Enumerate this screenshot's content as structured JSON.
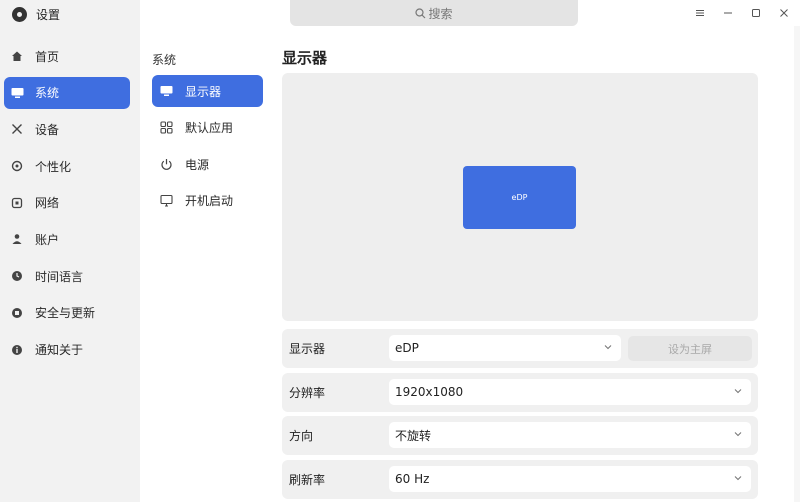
{
  "app": {
    "title": "设置"
  },
  "search": {
    "placeholder": "搜索"
  },
  "sidebar": {
    "items": [
      {
        "label": "首页",
        "icon": "home-icon"
      },
      {
        "label": "系统",
        "icon": "monitor-icon",
        "active": true
      },
      {
        "label": "设备",
        "icon": "tools-icon"
      },
      {
        "label": "个性化",
        "icon": "palette-icon"
      },
      {
        "label": "网络",
        "icon": "network-icon"
      },
      {
        "label": "账户",
        "icon": "user-icon"
      },
      {
        "label": "时间语言",
        "icon": "clock-icon"
      },
      {
        "label": "安全与更新",
        "icon": "shield-icon"
      },
      {
        "label": "通知关于",
        "icon": "info-icon"
      }
    ]
  },
  "subnav": {
    "heading": "系统",
    "items": [
      {
        "label": "显示器",
        "icon": "monitor-icon",
        "active": true
      },
      {
        "label": "默认应用",
        "icon": "apps-grid-icon"
      },
      {
        "label": "电源",
        "icon": "power-icon"
      },
      {
        "label": "开机启动",
        "icon": "startup-icon"
      }
    ]
  },
  "main": {
    "title": "显示器",
    "preview": {
      "monitor_label": "eDP"
    },
    "rows": [
      {
        "label": "显示器",
        "value": "eDP",
        "button": "设为主屏"
      },
      {
        "label": "分辨率",
        "value": "1920x1080"
      },
      {
        "label": "方向",
        "value": "不旋转"
      },
      {
        "label": "刷新率",
        "value": "60 Hz"
      }
    ]
  },
  "colors": {
    "accent": "#3f6ee0",
    "sidebar_bg": "#f2f2f2",
    "row_bg": "#f0f0f0"
  }
}
